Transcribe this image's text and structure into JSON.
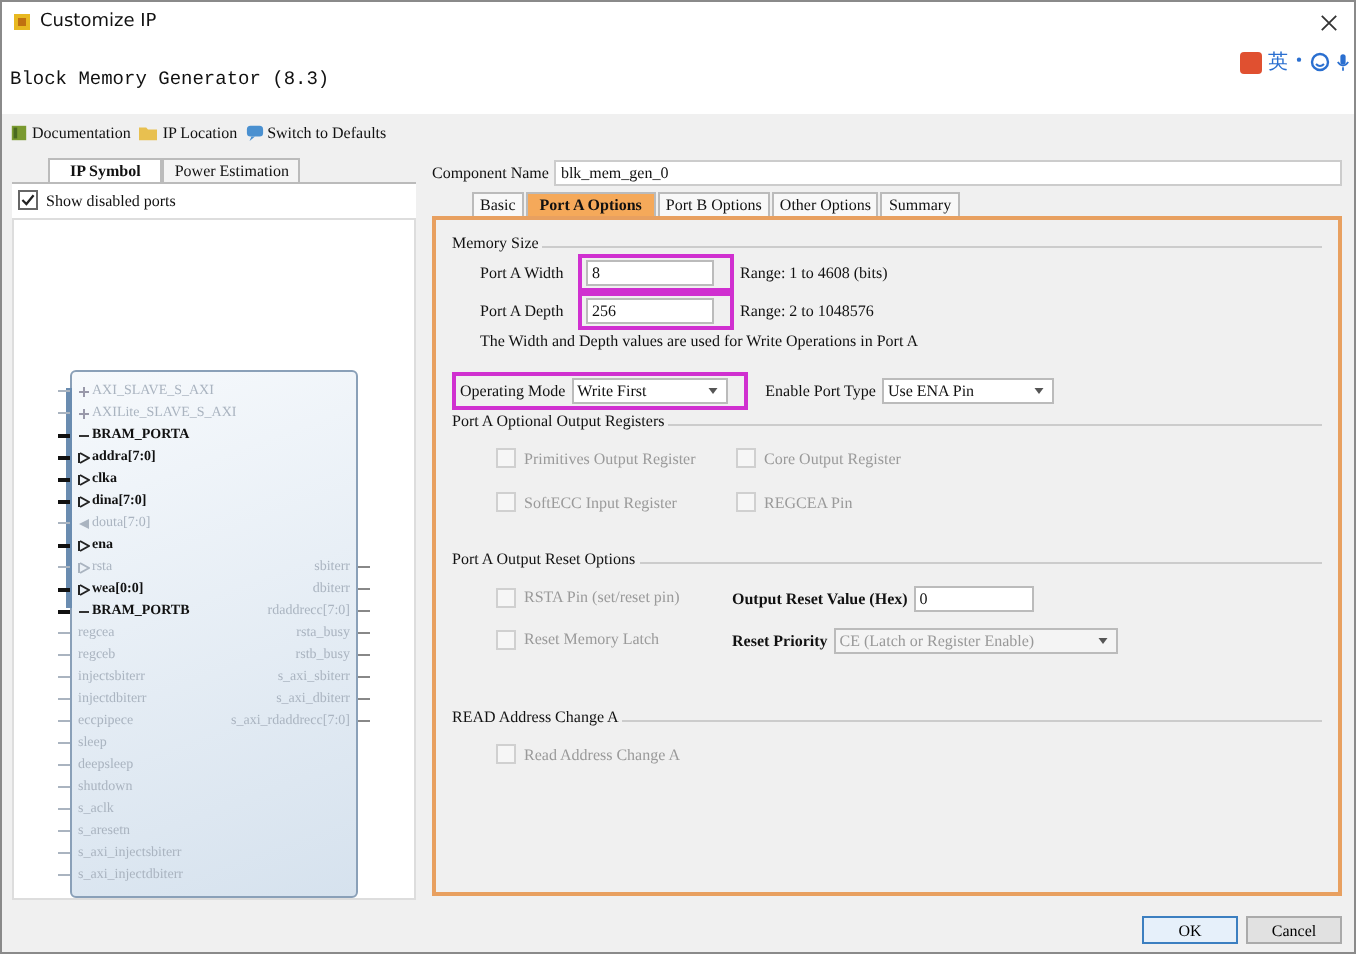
{
  "window": {
    "title": "Customize IP"
  },
  "ime_toolbar": {
    "label": "英"
  },
  "header": {
    "title": "Block Memory Generator (8.3)"
  },
  "toolbar": [
    {
      "label": "Documentation",
      "kind": "book"
    },
    {
      "label": "IP Location",
      "kind": "folder"
    },
    {
      "label": "Switch to Defaults",
      "kind": "refresh"
    }
  ],
  "left_tabs": [
    {
      "label": "IP Symbol",
      "selected": true
    },
    {
      "label": "Power Estimation",
      "selected": false
    }
  ],
  "show_disabled_ports": {
    "label": "Show disabled ports",
    "checked": true
  },
  "symbol": {
    "left_pins": [
      {
        "label": "AXI_SLAVE_S_AXI",
        "kind": "interface",
        "enabled": false
      },
      {
        "label": "AXILite_SLAVE_S_AXI",
        "kind": "interface",
        "enabled": false
      },
      {
        "label": "BRAM_PORTA",
        "kind": "interface",
        "enabled": true
      },
      {
        "label": "addra[7:0]",
        "kind": "input",
        "enabled": true
      },
      {
        "label": "clka",
        "kind": "input",
        "enabled": true
      },
      {
        "label": "dina[7:0]",
        "kind": "input",
        "enabled": true
      },
      {
        "label": "douta[7:0]",
        "kind": "output",
        "enabled": false
      },
      {
        "label": "ena",
        "kind": "input",
        "enabled": true
      },
      {
        "label": "rsta",
        "kind": "input",
        "enabled": false
      },
      {
        "label": "wea[0:0]",
        "kind": "input",
        "enabled": true
      },
      {
        "label": "BRAM_PORTB",
        "kind": "interface",
        "enabled": true
      },
      {
        "label": "regcea",
        "kind": "plain",
        "enabled": false
      },
      {
        "label": "regceb",
        "kind": "plain",
        "enabled": false
      },
      {
        "label": "injectsbiterr",
        "kind": "plain",
        "enabled": false
      },
      {
        "label": "injectdbiterr",
        "kind": "plain",
        "enabled": false
      },
      {
        "label": "eccpipece",
        "kind": "plain",
        "enabled": false
      },
      {
        "label": "sleep",
        "kind": "plain",
        "enabled": false
      },
      {
        "label": "deepsleep",
        "kind": "plain",
        "enabled": false
      },
      {
        "label": "shutdown",
        "kind": "plain",
        "enabled": false
      },
      {
        "label": "s_aclk",
        "kind": "plain",
        "enabled": false
      },
      {
        "label": "s_aresetn",
        "kind": "plain",
        "enabled": false
      },
      {
        "label": "s_axi_injectsbiterr",
        "kind": "plain",
        "enabled": false
      },
      {
        "label": "s_axi_injectdbiterr",
        "kind": "plain",
        "enabled": false
      }
    ],
    "right_pins": [
      {
        "label": "sbiterr",
        "enabled": false
      },
      {
        "label": "dbiterr",
        "enabled": false
      },
      {
        "label": "rdaddrecc[7:0]",
        "enabled": false
      },
      {
        "label": "rsta_busy",
        "enabled": false
      },
      {
        "label": "rstb_busy",
        "enabled": false
      },
      {
        "label": "s_axi_sbiterr",
        "enabled": false
      },
      {
        "label": "s_axi_dbiterr",
        "enabled": false
      },
      {
        "label": "s_axi_rdaddrecc[7:0]",
        "enabled": false
      }
    ]
  },
  "component_name": {
    "label": "Component Name",
    "value": "blk_mem_gen_0"
  },
  "tabs": [
    {
      "label": "Basic",
      "selected": false
    },
    {
      "label": "Port A Options",
      "selected": true
    },
    {
      "label": "Port B Options",
      "selected": false
    },
    {
      "label": "Other Options",
      "selected": false
    },
    {
      "label": "Summary",
      "selected": false
    }
  ],
  "memory_size": {
    "heading": "Memory Size",
    "fields": [
      {
        "label": "Port A Width",
        "value": "8",
        "range": "Range: 1 to 4608 (bits)"
      },
      {
        "label": "Port A Depth",
        "value": "256",
        "range": "Range: 2 to 1048576"
      }
    ],
    "note": "The Width and Depth values are used for Write Operations in Port A"
  },
  "operating_mode": {
    "label": "Operating Mode",
    "value": "Write First"
  },
  "enable_port_type": {
    "label": "Enable Port Type",
    "value": "Use ENA Pin"
  },
  "output_registers": {
    "heading": "Port A Optional Output Registers",
    "options": [
      {
        "label": "Primitives Output Register",
        "checked": false,
        "disabled": true
      },
      {
        "label": "Core Output Register",
        "checked": false,
        "disabled": true
      },
      {
        "label": "SoftECC Input Register",
        "checked": false,
        "disabled": true
      },
      {
        "label": "REGCEA Pin",
        "checked": false,
        "disabled": true
      }
    ]
  },
  "output_reset": {
    "heading": "Port A Output Reset Options",
    "rsta_pin": {
      "label": "RSTA Pin (set/reset pin)",
      "checked": false,
      "disabled": true
    },
    "reset_memory_latch": {
      "label": "Reset Memory Latch",
      "checked": false,
      "disabled": true
    },
    "reset_value": {
      "label": "Output Reset Value (Hex)",
      "value": "0"
    },
    "reset_priority": {
      "label": "Reset Priority",
      "value": "CE (Latch or Register Enable)",
      "disabled": true
    }
  },
  "read_address_change": {
    "heading": "READ Address Change A",
    "option": {
      "label": "Read Address Change A",
      "checked": false,
      "disabled": true
    }
  },
  "buttons": [
    {
      "label": "OK",
      "kind": "default"
    },
    {
      "label": "Cancel",
      "kind": "normal"
    }
  ]
}
